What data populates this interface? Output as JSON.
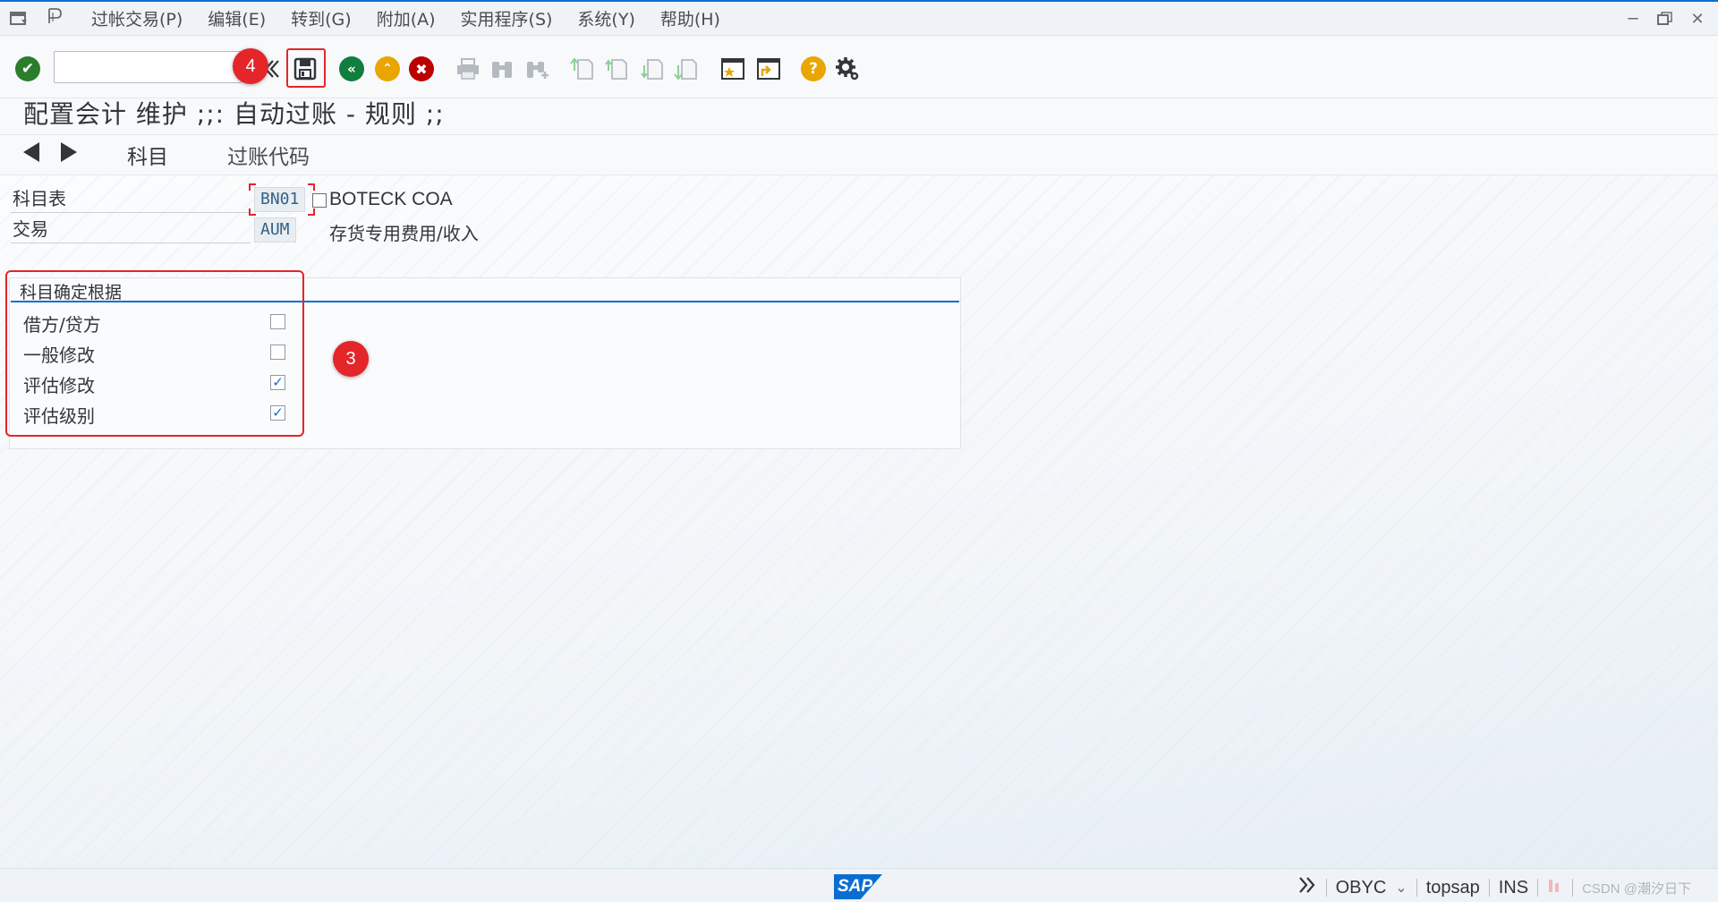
{
  "menubar": {
    "items": [
      "过帐交易(P)",
      "编辑(E)",
      "转到(G)",
      "附加(A)",
      "实用程序(S)",
      "系统(Y)",
      "帮助(H)"
    ]
  },
  "toolbar": {
    "command_field_value": "",
    "annotation_save": "4"
  },
  "title": "配置会计 维护 ;;: 自动过账 - 规则 ;;",
  "nav": {
    "tabs": [
      "科目",
      "过账代码"
    ]
  },
  "fields": {
    "chart_of_accounts": {
      "label": "科目表",
      "value": "BN01",
      "description": "BOTECK COA"
    },
    "transaction": {
      "label": "交易",
      "value": "AUM",
      "description": "存货专用费用/收入"
    }
  },
  "group": {
    "title": "科目确定根据",
    "annotation": "3",
    "items": [
      {
        "label": "借方/贷方",
        "checked": false
      },
      {
        "label": "一般修改",
        "checked": false
      },
      {
        "label": "评估修改",
        "checked": true
      },
      {
        "label": "评估级别",
        "checked": true
      }
    ]
  },
  "statusbar": {
    "logo": "SAP",
    "transaction_code": "OBYC",
    "server": "topsap",
    "mode": "INS",
    "watermark": "CSDN @潮汐日下"
  },
  "colors": {
    "accent": "#0a6ed1",
    "annotation_red": "#e4252a",
    "ok_green": "#2b7d2b",
    "back_green": "#107e3e",
    "exit_orange": "#e9a500",
    "cancel_red": "#bb0000",
    "help_yellow": "#e9a500"
  }
}
